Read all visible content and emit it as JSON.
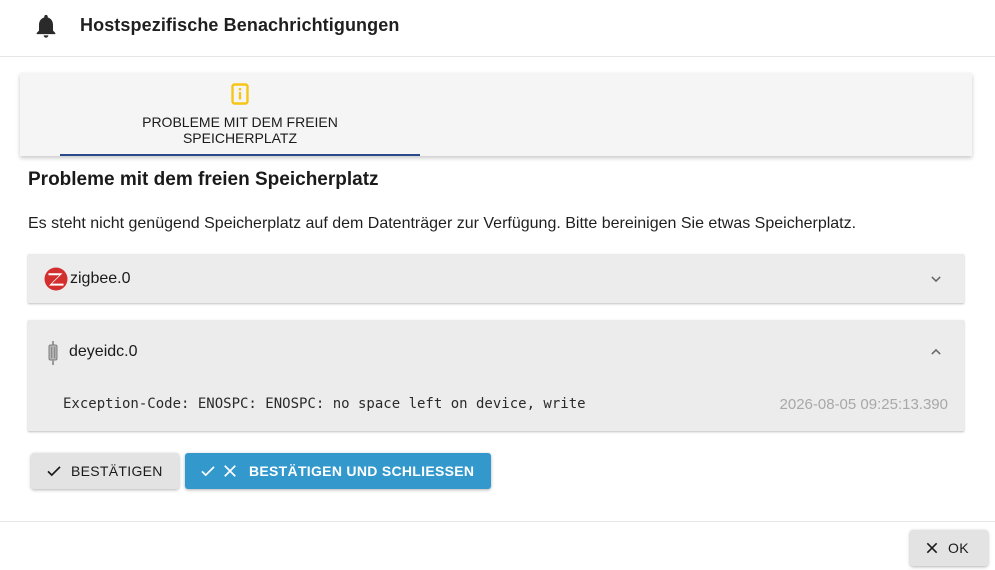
{
  "header": {
    "title": "Hostspezifische Benachrichtigungen",
    "icon": "bell-icon"
  },
  "tabs": [
    {
      "label": "PROBLEME MIT DEM FREIEN SPEICHERPLATZ",
      "icon": "info-icon",
      "icon_color": "#f5c518",
      "active": true
    }
  ],
  "section": {
    "title": "Probleme mit dem freien Speicherplatz",
    "description": "Es steht nicht genügend Speicherplatz auf dem Datenträger zur Verfügung. Bitte bereinigen Sie etwas Speicherplatz."
  },
  "panels": [
    {
      "name": "zigbee.0",
      "icon": "zigbee-logo-icon",
      "expanded": false
    },
    {
      "name": "deyeidc.0",
      "icon": "inverter-icon",
      "expanded": true,
      "message": "Exception-Code: ENOSPC: ENOSPC: no space left on device, write",
      "timestamp": "2026-08-05 09:25:13.390"
    }
  ],
  "actions": {
    "confirm_label": "BESTÄTIGEN",
    "confirm_close_label": "BESTÄTIGEN UND SCHLIESSEN",
    "ok_label": "OK"
  },
  "colors": {
    "accent": "#3399cc",
    "tab_indicator": "#2b4a8b",
    "zigbee_red": "#d32f2f"
  }
}
